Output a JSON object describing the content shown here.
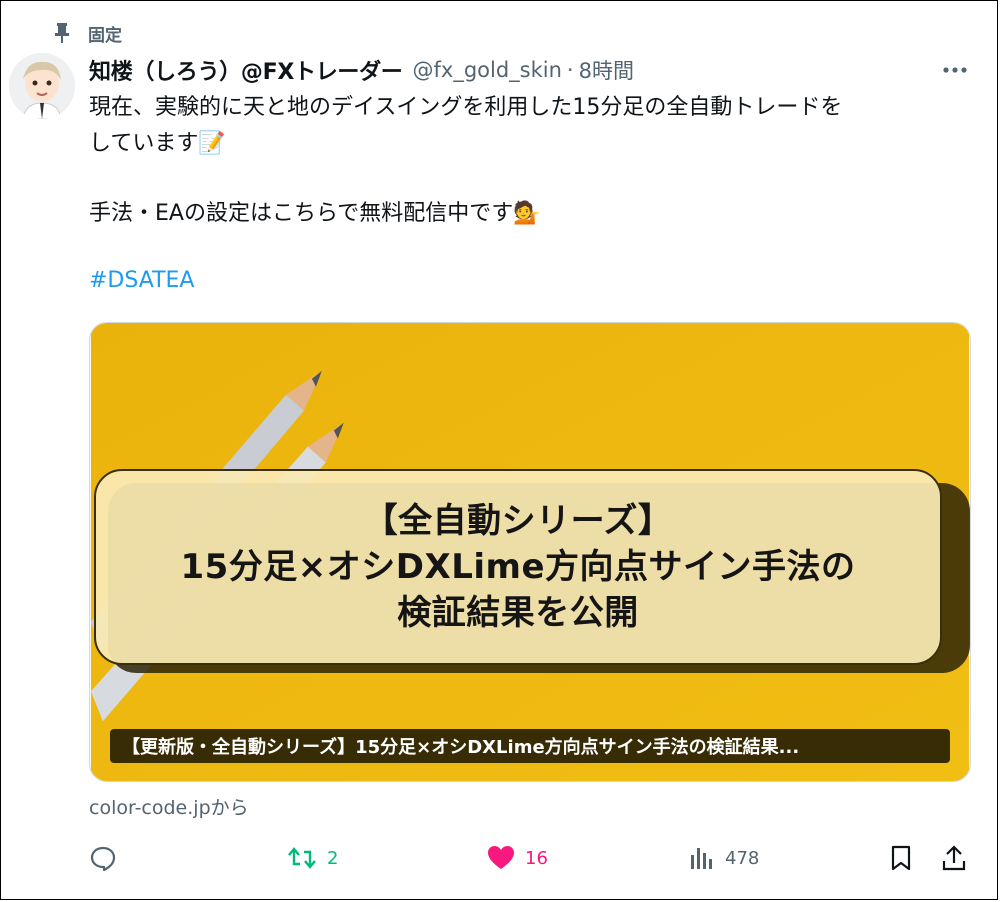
{
  "pinned": {
    "label": "固定",
    "icon": "pin-icon"
  },
  "author": {
    "display_name": "知楼（しろう）@FXトレーダー",
    "handle": "@fx_gold_skin",
    "separator": "·",
    "time": "8時間"
  },
  "post": {
    "line1": "現在、実験的に天と地のデイスイングを利用した15分足の全自動トレードを",
    "line2": "しています",
    "line2_emoji": "📝",
    "line3": "手法・EAの設定はこちらで無料配信中です",
    "line3_emoji": "💁",
    "hashtag": "#DSATEA"
  },
  "card": {
    "title_line1": "【全自動シリーズ】",
    "title_line2": "15分足×オシDXLime方向点サイン手法の",
    "title_line3": "検証結果を公開",
    "caption": "【更新版・全自動シリーズ】15分足×オシDXLime方向点サイン手法の検証結果...",
    "source": "color-code.jpから"
  },
  "actions": {
    "reply": {
      "icon": "reply-icon",
      "count": ""
    },
    "retweet": {
      "icon": "retweet-icon",
      "count": "2"
    },
    "like": {
      "icon": "heart-icon",
      "count": "16"
    },
    "views": {
      "icon": "views-icon",
      "count": "478"
    },
    "bookmark": {
      "icon": "bookmark-icon"
    },
    "share": {
      "icon": "share-icon"
    }
  },
  "colors": {
    "text": "#0f1419",
    "secondary": "#536471",
    "link": "#1d9bf0",
    "retweet": "#00ba7c",
    "like": "#f91880",
    "card_yellow": "#eab308"
  }
}
